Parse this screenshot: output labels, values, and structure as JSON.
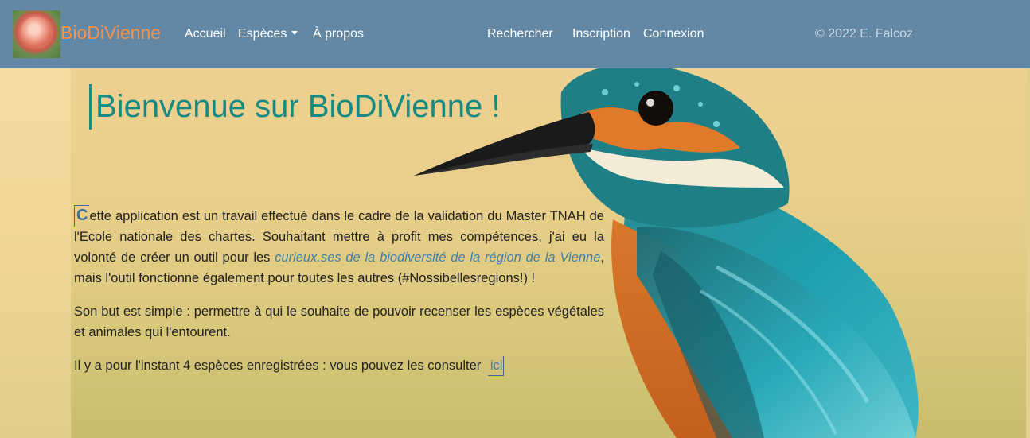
{
  "navbar": {
    "brand": "BioDiVienne",
    "links": {
      "home": "Accueil",
      "species": "Espèces",
      "about": "À propos",
      "search": "Rechercher",
      "signup": "Inscription",
      "login": "Connexion"
    },
    "copyright": "© 2022 E. Falcoz",
    "background_color": "#6288a5",
    "brand_color": "#f0934f"
  },
  "main": {
    "title": "Bienvenue sur BioDiVienne !",
    "title_color": "#178a84",
    "paragraph1": {
      "dropcap": "C",
      "text_before": "ette application est un travail effectué dans le cadre de la validation du Master TNAH de l'Ecole nationale des chartes. Souhaitant mettre à profit mes compétences, j'ai eu la volonté de créer un outil pour les ",
      "highlight": "curieux.ses de la biodiversité de la région de la Vienne",
      "text_after": ", mais l'outil fonctionne également pour toutes les autres (#Nossibellesregions!) !"
    },
    "paragraph2": "Son but est simple : permettre à qui le souhaite de pouvoir recenser les espèces végétales et animales qui l'entourent.",
    "paragraph3": {
      "text": "Il y a pour l'instant 4 espèces enregistrées : vous pouvez les consulter",
      "link": "ici"
    }
  },
  "icons": {
    "species_dropdown": "chevron-down-icon",
    "logo": "flower-logo-icon",
    "background": "kingfisher-bird-image"
  }
}
